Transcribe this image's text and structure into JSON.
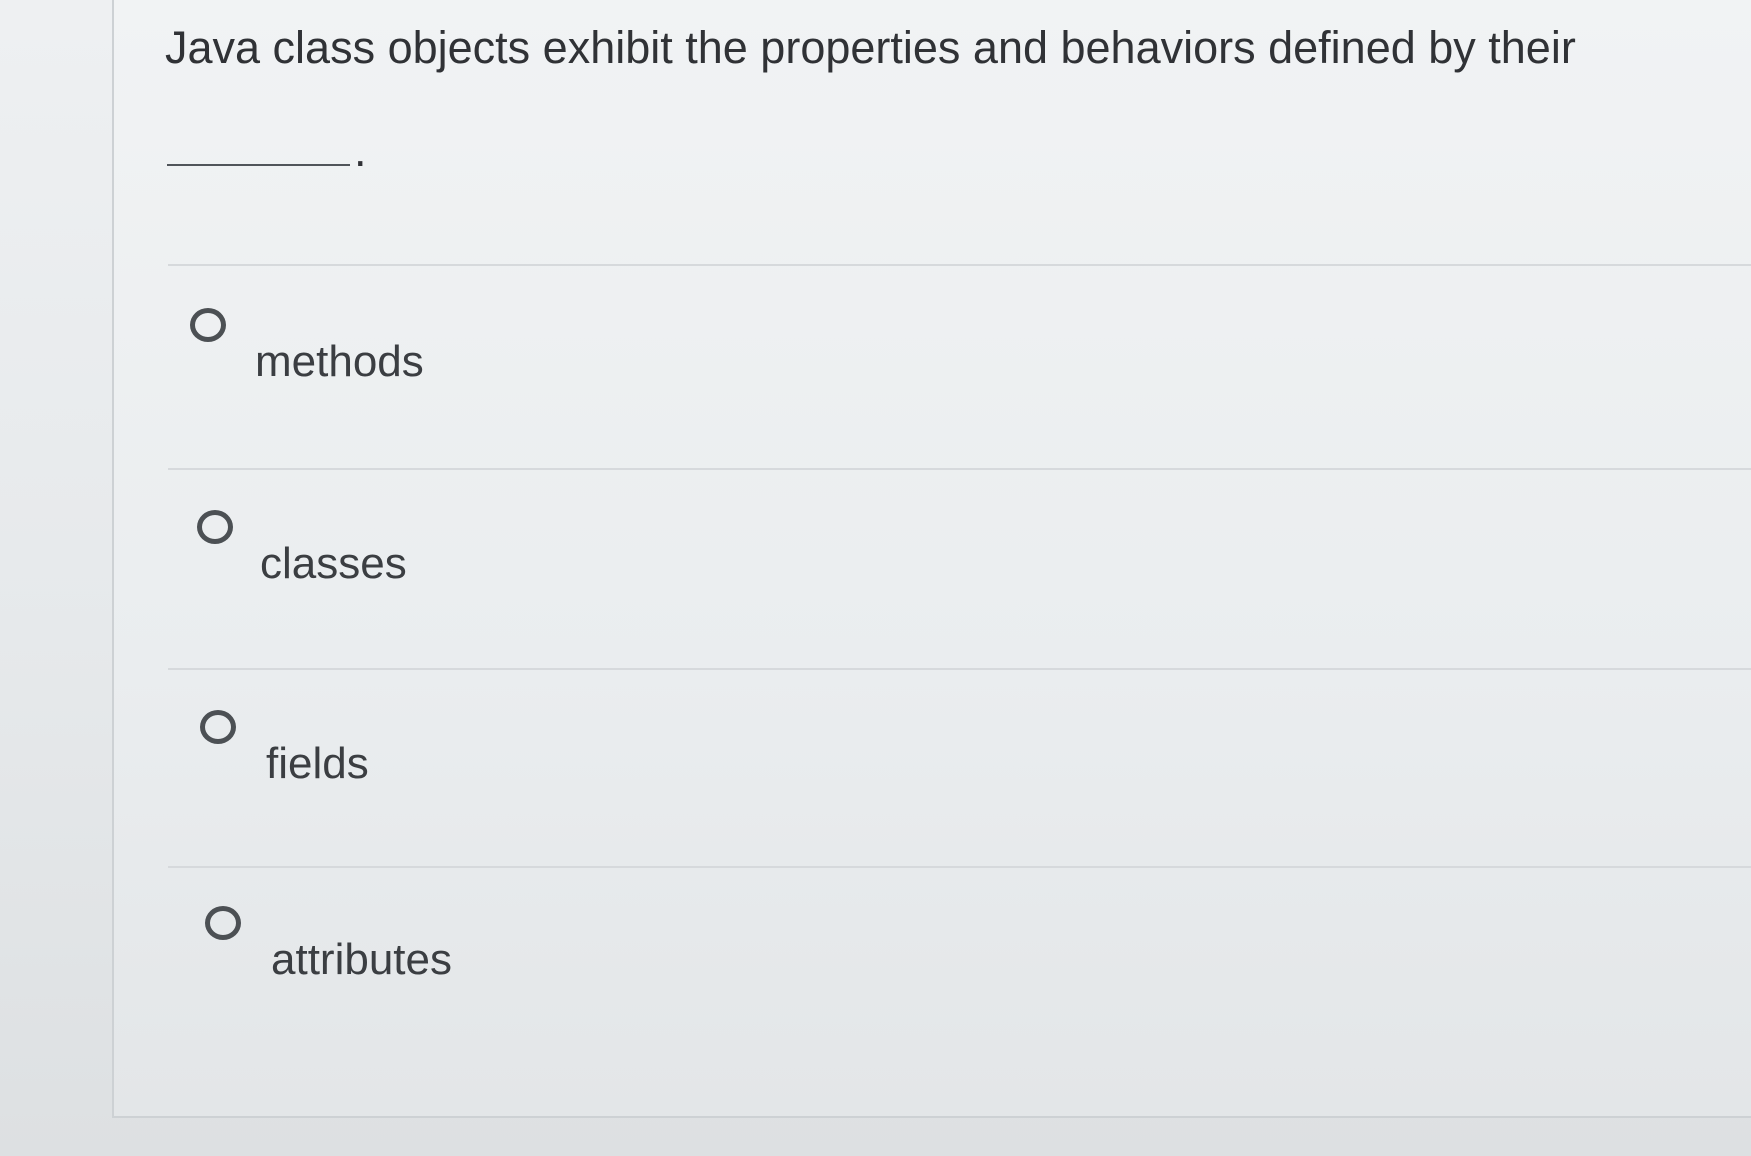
{
  "question": {
    "text": "Java class objects exhibit the properties and behaviors defined by their",
    "blank_suffix": "."
  },
  "options": [
    {
      "label": "methods"
    },
    {
      "label": "classes"
    },
    {
      "label": "fields"
    },
    {
      "label": "attributes"
    }
  ]
}
